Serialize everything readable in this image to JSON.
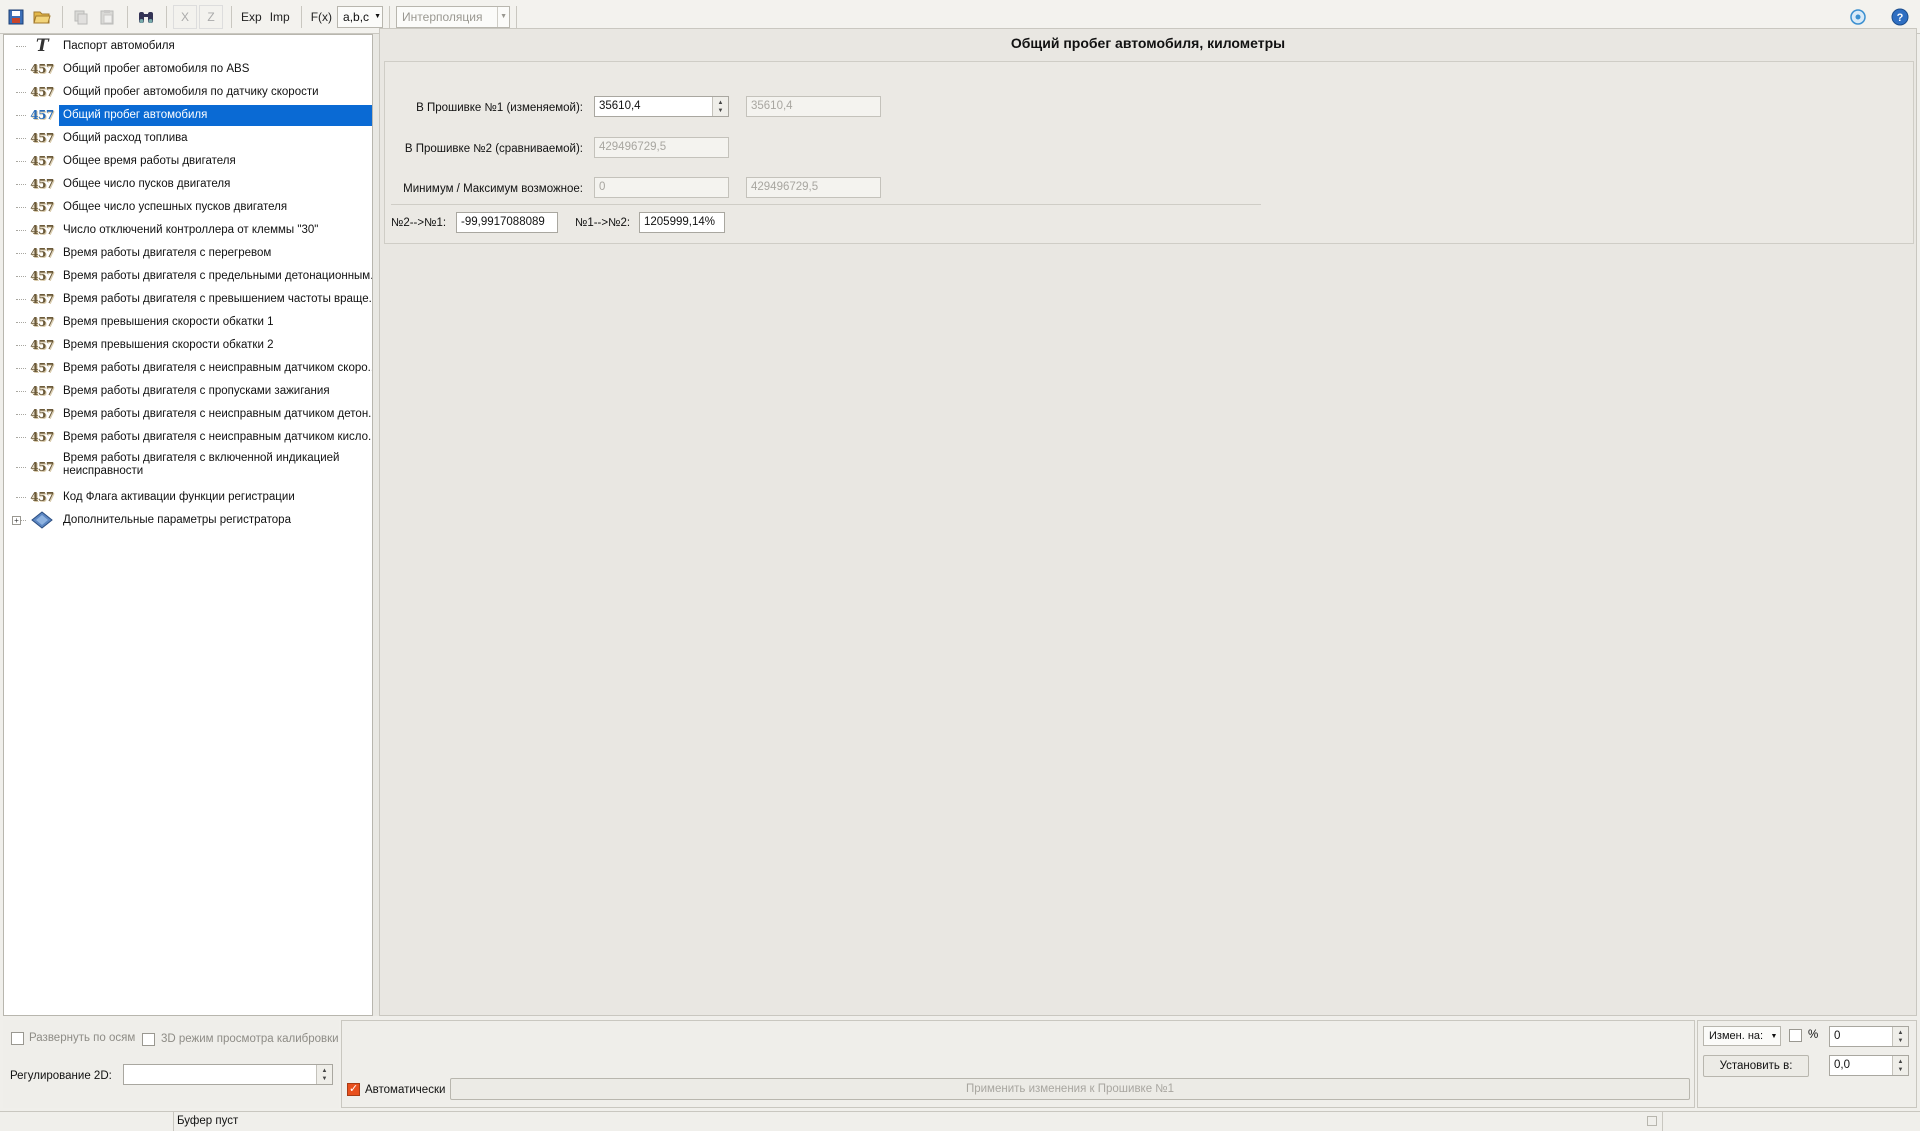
{
  "toolbar": {
    "exp_label": "Exp",
    "imp_label": "Imp",
    "x_label": "X",
    "z_label": "Z",
    "fx_label": "F(x)",
    "format_combo": "a,b,c",
    "interpolation_combo": "Интерполяция"
  },
  "tree": {
    "items": [
      {
        "label": "Паспорт автомобиля",
        "icon": "text-T-icon"
      },
      {
        "label": "Общий пробег автомобиля по ABS",
        "icon": "number-457-icon"
      },
      {
        "label": "Общий пробег автомобиля по датчику скорости",
        "icon": "number-457-icon"
      },
      {
        "label": "Общий пробег автомобиля",
        "icon": "number-457-icon"
      },
      {
        "label": "Общий расход топлива",
        "icon": "number-457-icon"
      },
      {
        "label": "Общее время работы двигателя",
        "icon": "number-457-icon"
      },
      {
        "label": "Общее число пусков двигателя",
        "icon": "number-457-icon"
      },
      {
        "label": "Общее число успешных пусков двигателя",
        "icon": "number-457-icon"
      },
      {
        "label": "Число отключений контроллера от клеммы \"30\"",
        "icon": "number-457-icon"
      },
      {
        "label": "Время работы двигателя с перегревом",
        "icon": "number-457-icon"
      },
      {
        "label": "Время работы двигателя с предельными детонационным...",
        "icon": "number-457-icon"
      },
      {
        "label": "Время работы двигателя с превышением частоты враще...",
        "icon": "number-457-icon"
      },
      {
        "label": "Время превышения скорости обкатки 1",
        "icon": "number-457-icon"
      },
      {
        "label": "Время превышения скорости обкатки 2",
        "icon": "number-457-icon"
      },
      {
        "label": "Время работы двигателя с неисправным датчиком скоро...",
        "icon": "number-457-icon"
      },
      {
        "label": "Время работы двигателя с пропусками зажигания",
        "icon": "number-457-icon"
      },
      {
        "label": "Время работы двигателя с неисправным датчиком детон...",
        "icon": "number-457-icon"
      },
      {
        "label": "Время работы двигателя с неисправным датчиком кисло...",
        "icon": "number-457-icon"
      },
      {
        "label": "Время работы двигателя с включенной индикацией неисправности",
        "icon": "number-457-icon"
      },
      {
        "label": "Код Флага активации функции регистрации",
        "icon": "number-457-icon"
      },
      {
        "label": "Дополнительные параметры регистратора",
        "icon": "folder-diamond-icon"
      }
    ],
    "selected": "Общий пробег автомобиля"
  },
  "param": {
    "title": "Общий пробег автомобиля, километры",
    "fw1_label": "В Прошивке №1 (изменяемой):",
    "fw1_value": "35610,4",
    "fw1_orig": "35610,4",
    "fw2_label": "В Прошивке №2 (сравниваемой):",
    "fw2_value": "429496729,5",
    "minmax_label": "Минимум / Максимум возможное:",
    "min_value": "0",
    "max_value": "429496729,5",
    "diff21_label": "№2-->№1:",
    "diff21_value": "-99,9917088089",
    "diff12_label": "№1-->№2:",
    "diff12_value": "1205999,14%"
  },
  "bottom": {
    "expand_axes": "Развернуть по осям",
    "mode_3d": "3D режим просмотра калибровки",
    "regulation_2d": "Регулирование 2D:",
    "regulation_2d_value": "",
    "auto_label": "Автоматически",
    "apply_button": "Применить изменения к Прошивке №1",
    "change_by_combo": "Измен. на:",
    "percent_label": "%",
    "change_value": "0",
    "set_to_button": "Установить в:",
    "set_value": "0,0"
  },
  "status": {
    "buffer": "Буфер пуст"
  },
  "colors": {
    "selection": "#0a6ad4",
    "checkbox_checked": "#e8501d"
  }
}
